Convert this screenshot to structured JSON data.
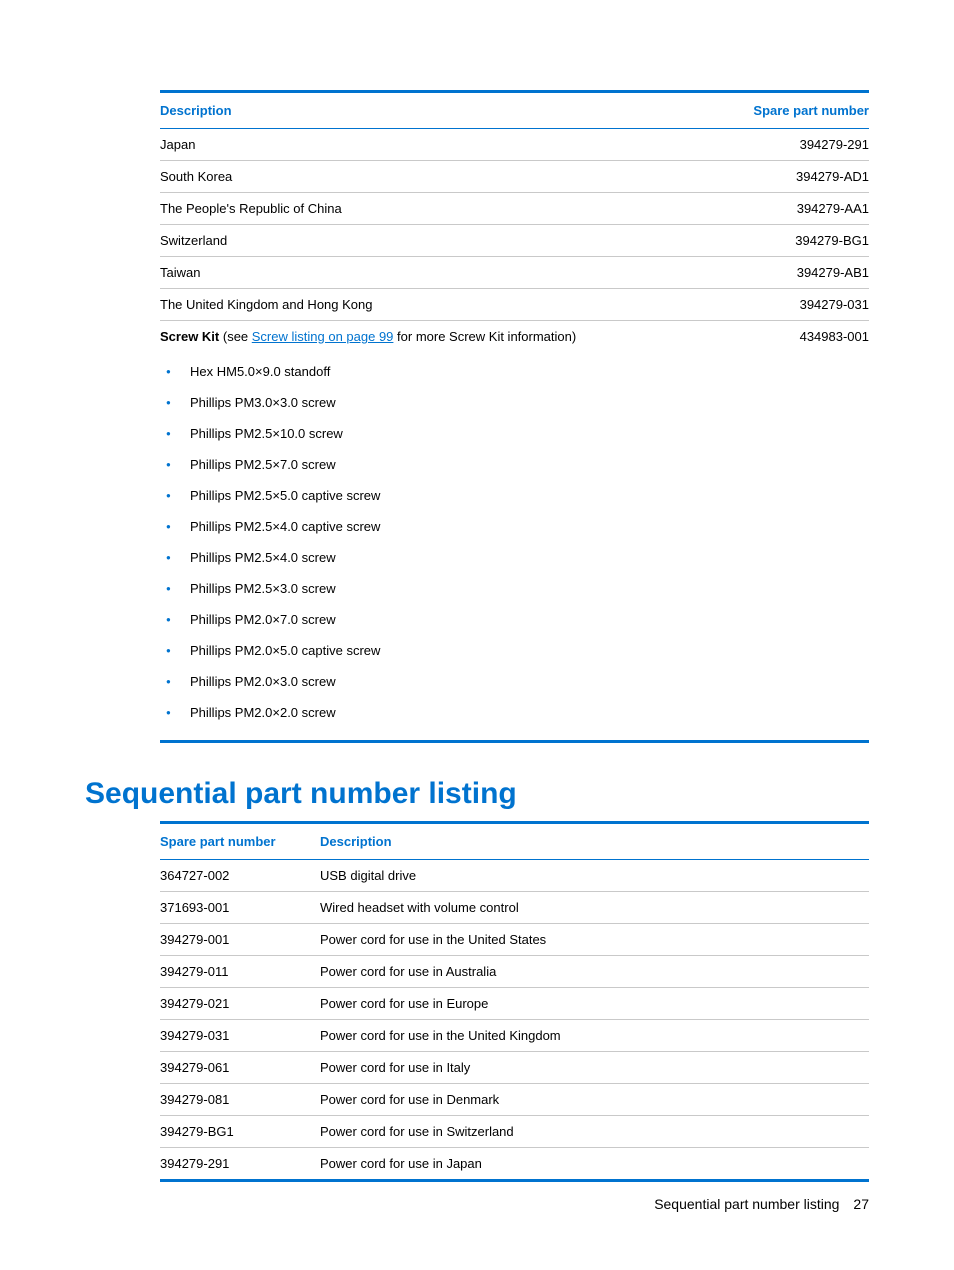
{
  "table1": {
    "headers": {
      "desc": "Description",
      "part": "Spare part number"
    },
    "rows": [
      {
        "desc": "Japan",
        "part": "394279-291"
      },
      {
        "desc": "South Korea",
        "part": "394279-AD1"
      },
      {
        "desc": "The People's Republic of China",
        "part": "394279-AA1"
      },
      {
        "desc": "Switzerland",
        "part": "394279-BG1"
      },
      {
        "desc": "Taiwan",
        "part": "394279-AB1"
      },
      {
        "desc": "The United Kingdom and Hong Kong",
        "part": "394279-031"
      }
    ],
    "screw_kit": {
      "label_bold": "Screw Kit",
      "label_see": " (see ",
      "link_text": "Screw listing on page 99",
      "label_after": " for more Screw Kit information)",
      "part": "434983-001"
    },
    "bullets": [
      "Hex HM5.0×9.0 standoff",
      "Phillips PM3.0×3.0 screw",
      "Phillips PM2.5×10.0 screw",
      "Phillips PM2.5×7.0 screw",
      "Phillips PM2.5×5.0 captive screw",
      "Phillips PM2.5×4.0 captive screw",
      "Phillips PM2.5×4.0 screw",
      "Phillips PM2.5×3.0 screw",
      "Phillips PM2.0×7.0 screw",
      "Phillips PM2.0×5.0 captive screw",
      "Phillips PM2.0×3.0 screw",
      "Phillips PM2.0×2.0 screw"
    ]
  },
  "heading": "Sequential part number listing",
  "table2": {
    "headers": {
      "part": "Spare part number",
      "desc": "Description"
    },
    "rows": [
      {
        "part": "364727-002",
        "desc": "USB digital drive"
      },
      {
        "part": "371693-001",
        "desc": "Wired headset with volume control"
      },
      {
        "part": "394279-001",
        "desc": "Power cord for use in the United States"
      },
      {
        "part": "394279-011",
        "desc": "Power cord for use in Australia"
      },
      {
        "part": "394279-021",
        "desc": "Power cord for use in Europe"
      },
      {
        "part": "394279-031",
        "desc": "Power cord for use in the United Kingdom"
      },
      {
        "part": "394279-061",
        "desc": "Power cord for use in Italy"
      },
      {
        "part": "394279-081",
        "desc": "Power cord for use in Denmark"
      },
      {
        "part": "394279-BG1",
        "desc": "Power cord for use in Switzerland"
      },
      {
        "part": "394279-291",
        "desc": "Power cord for use in Japan"
      }
    ]
  },
  "footer": {
    "text": "Sequential part number listing",
    "page": "27"
  }
}
